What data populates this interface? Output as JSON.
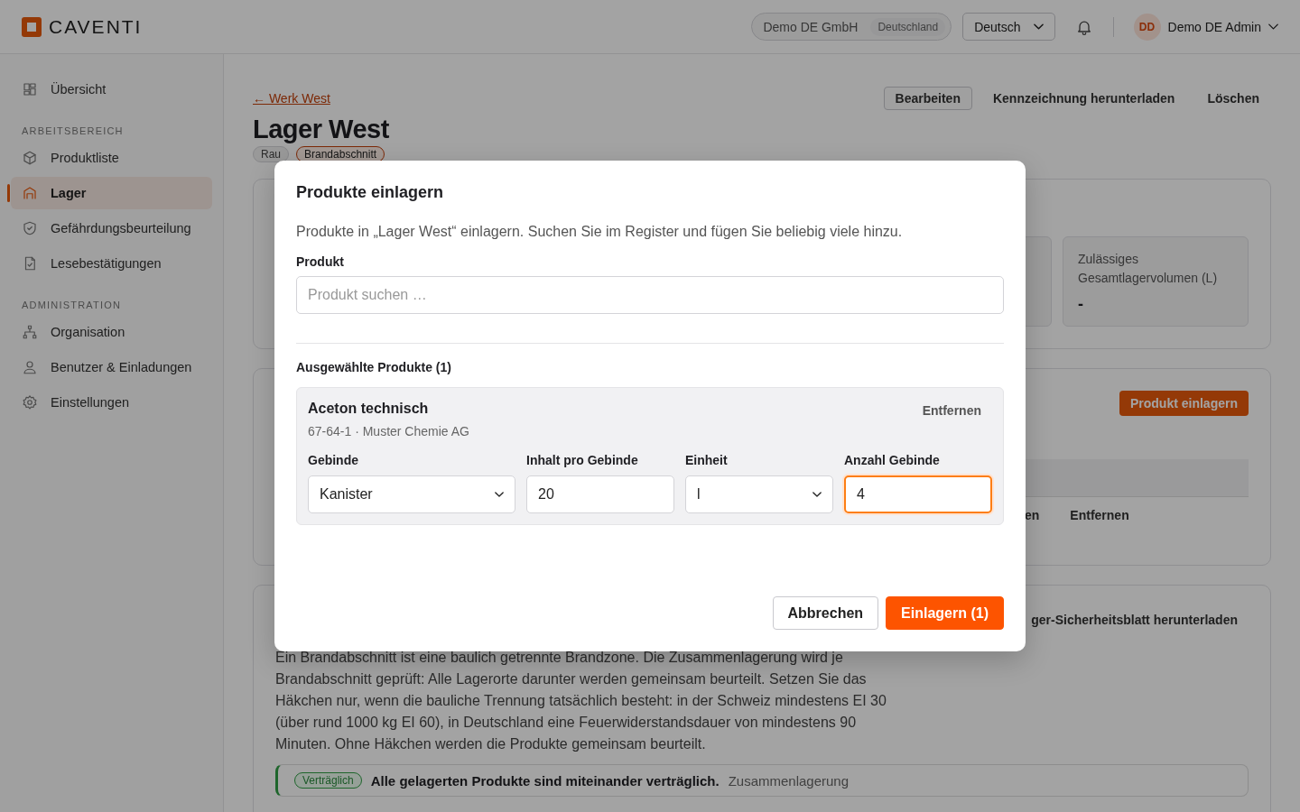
{
  "header": {
    "brand": "CAVENTI",
    "org": {
      "name": "Demo DE GmbH",
      "country": "Deutschland"
    },
    "language": "Deutsch",
    "user": {
      "initials": "DD",
      "name": "Demo DE Admin"
    }
  },
  "sidebar": {
    "sections": [
      {
        "items": [
          {
            "label": "Übersicht",
            "selected": false
          }
        ]
      },
      {
        "heading": "ARBEITSBEREICH",
        "items": [
          {
            "label": "Produktliste",
            "selected": false
          },
          {
            "label": "Lager",
            "selected": true
          },
          {
            "label": "Gefährdungsbeurteilung",
            "selected": false
          },
          {
            "label": "Lesebestätigungen",
            "selected": false
          }
        ]
      },
      {
        "heading": "ADMINISTRATION",
        "items": [
          {
            "label": "Organisation",
            "selected": false
          },
          {
            "label": "Benutzer & Einladungen",
            "selected": false
          },
          {
            "label": "Einstellungen",
            "selected": false
          }
        ]
      }
    ]
  },
  "page": {
    "breadcrumb": "← Werk West",
    "title": "Lager West",
    "actions": [
      {
        "label": "Bearbeiten",
        "kind": "outline"
      },
      {
        "label": "Kennzeichnung herunterladen",
        "kind": "text"
      },
      {
        "label": "Löschen",
        "kind": "text"
      }
    ],
    "tags": [
      {
        "label": "Rau",
        "kind": "neutral"
      },
      {
        "label": "Brandabschnitt",
        "kind": "accent"
      }
    ],
    "stats": [
      {
        "label": "Zulässiges Gesamtlagervolumen (L)",
        "value": "-"
      }
    ],
    "products_card": {
      "button": "Produkt einlagern",
      "row": [
        "en",
        "Entfernen"
      ]
    },
    "info_card": {
      "link": "ger-Sicherheitsblatt herunterladen",
      "paragraph": "Ein Brandabschnitt ist eine baulich getrennte Brandzone. Die Zusammenlagerung wird je Brandabschnitt geprüft: Alle Lagerorte darunter werden gemeinsam beurteilt. Setzen Sie das Häkchen nur, wenn die bauliche Trennung tatsächlich besteht: in der Schweiz mindestens EI 30 (über rund 1000 kg EI 60), in Deutschland eine Feuerwiderstandsdauer von mindestens 90 Minuten. Ohne Häkchen werden die Produkte gemeinsam beurteilt.",
      "alert": {
        "badge": "Verträglich",
        "title": "Alle gelagerten Produkte sind miteinander verträglich.",
        "text": "Zusammenlagerung"
      }
    }
  },
  "modal": {
    "title": "Produkte einlagern",
    "description": "Produkte in „Lager West“ einlagern. Suchen Sie im Register und fügen Sie beliebig viele hinzu.",
    "product_label": "Produkt",
    "search": {
      "placeholder": "Produkt suchen …"
    },
    "selected_heading": "Ausgewählte Produkte (1)",
    "items": [
      {
        "name": "Aceton technisch",
        "meta": "67-64-1 · Muster Chemie AG",
        "remove": "Entfernen",
        "fields": [
          {
            "label": "Gebinde",
            "value": "Kanister",
            "kind": "select",
            "focused": false
          },
          {
            "label": "Inhalt pro Gebinde",
            "value": "20",
            "kind": "input",
            "focused": false
          },
          {
            "label": "Einheit",
            "value": "l",
            "kind": "select",
            "focused": false
          },
          {
            "label": "Anzahl Gebinde",
            "value": "4",
            "kind": "input",
            "focused": true
          }
        ]
      }
    ],
    "buttons": [
      {
        "label": "Abbrechen",
        "kind": "secondary"
      },
      {
        "label": "Einlagern (1)",
        "kind": "primary"
      }
    ]
  }
}
